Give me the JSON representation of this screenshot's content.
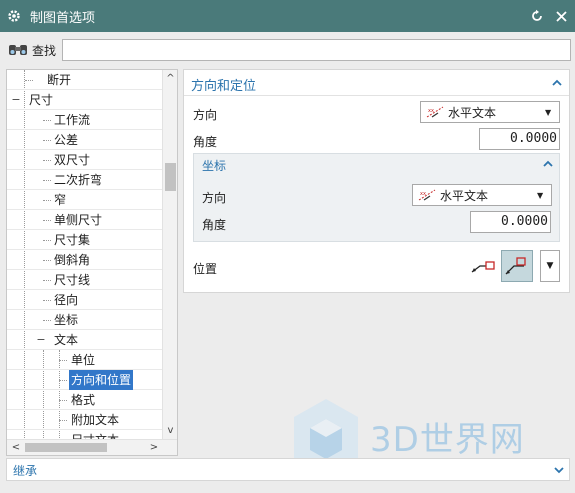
{
  "window": {
    "title": "制图首选项",
    "icons": {
      "app": "gear-icon",
      "reset": "reset-icon",
      "close": "close-icon"
    }
  },
  "search": {
    "label": "查找",
    "value": "",
    "icon": "binoculars-icon"
  },
  "tree": {
    "items": [
      {
        "label": "断开",
        "level": 1
      },
      {
        "label": "尺寸",
        "level": 0,
        "expanded": true
      },
      {
        "label": "工作流",
        "level": 1
      },
      {
        "label": "公差",
        "level": 1
      },
      {
        "label": "双尺寸",
        "level": 1
      },
      {
        "label": "二次折弯",
        "level": 1
      },
      {
        "label": "窄",
        "level": 1
      },
      {
        "label": "单侧尺寸",
        "level": 1
      },
      {
        "label": "尺寸集",
        "level": 1
      },
      {
        "label": "倒斜角",
        "level": 1
      },
      {
        "label": "尺寸线",
        "level": 1
      },
      {
        "label": "径向",
        "level": 1
      },
      {
        "label": "坐标",
        "level": 1
      },
      {
        "label": "文本",
        "level": 1,
        "expanded": true
      },
      {
        "label": "单位",
        "level": 2
      },
      {
        "label": "方向和位置",
        "level": 2,
        "selected": true
      },
      {
        "label": "格式",
        "level": 2
      },
      {
        "label": "附加文本",
        "level": 2
      },
      {
        "label": "尺寸文本",
        "level": 2
      }
    ]
  },
  "orientation_section": {
    "title": "方向和定位",
    "orientation_label": "方向",
    "orientation_value": "水平文本",
    "angle_label": "角度",
    "angle_value": "0.0000",
    "ordinate": {
      "title": "坐标",
      "orientation_label": "方向",
      "orientation_value": "水平文本",
      "angle_label": "角度",
      "angle_value": "0.0000"
    },
    "position_label": "位置"
  },
  "inherit": {
    "label": "继承"
  },
  "watermark": {
    "text": "3D世界网"
  },
  "colors": {
    "titlebar": "#4a7a7a",
    "accent": "#2c74ad",
    "selection": "#3277c9",
    "subgroup_bg": "#eef1f3"
  }
}
